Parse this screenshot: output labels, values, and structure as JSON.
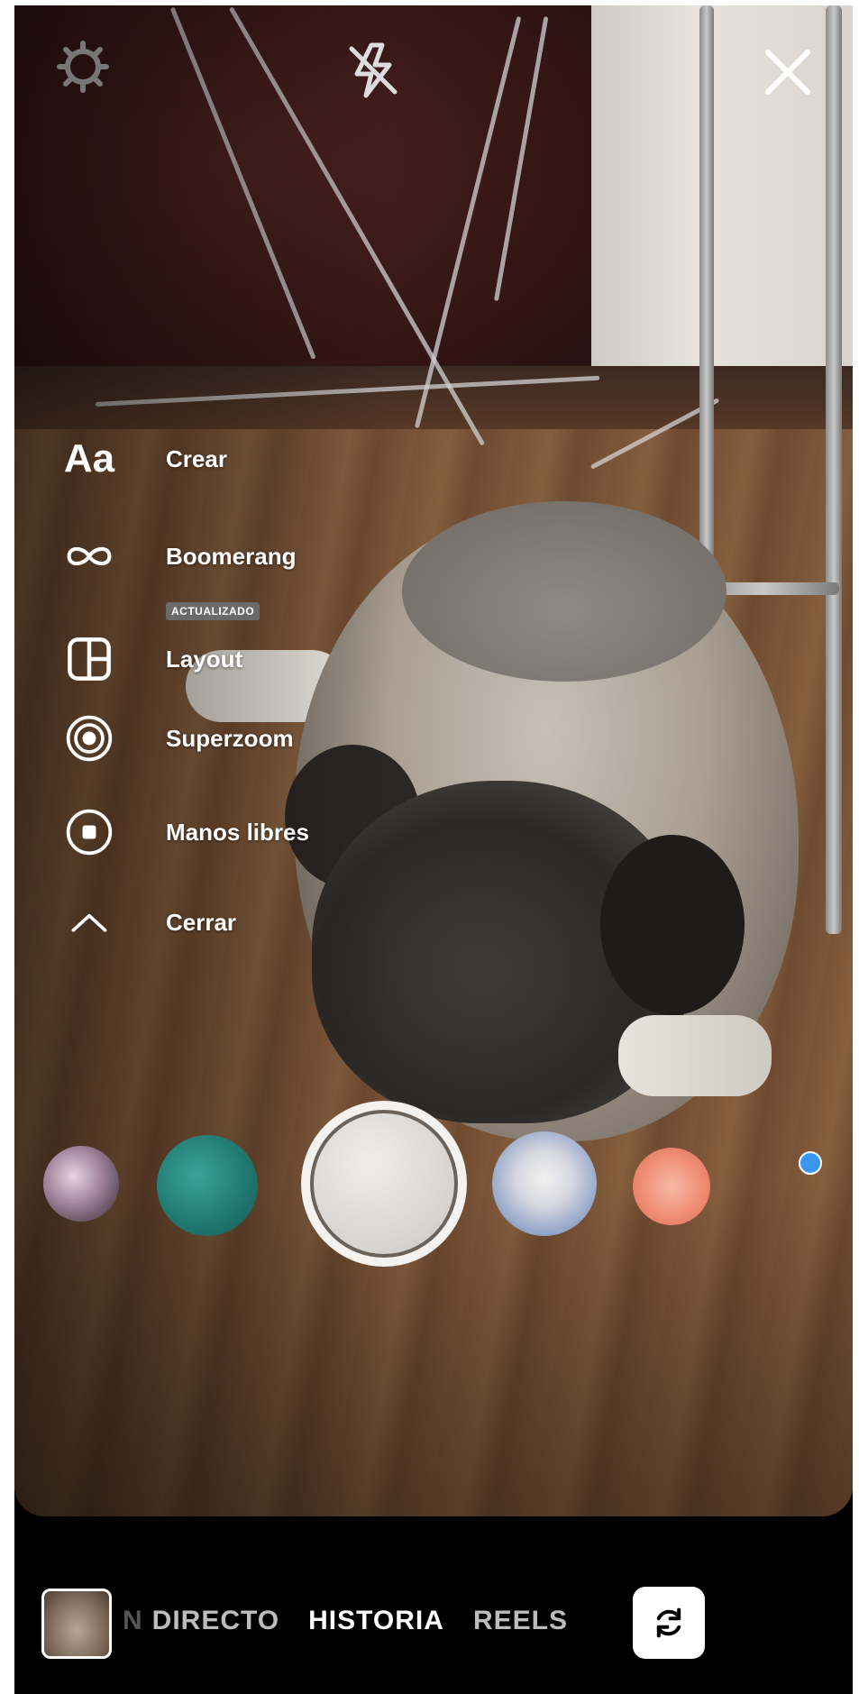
{
  "top_bar": {
    "settings_icon": "gear-icon",
    "flash_icon": "flash-off-icon",
    "close_icon": "close-icon"
  },
  "create_menu": {
    "items": [
      {
        "icon": "Aa",
        "label": "Crear"
      },
      {
        "icon": "infinity-icon",
        "label": "Boomerang"
      },
      {
        "icon": "layout-icon",
        "label": "Layout",
        "badge": "ACTUALIZADO"
      },
      {
        "icon": "superzoom-icon",
        "label": "Superzoom"
      },
      {
        "icon": "record-icon",
        "label": "Manos libres"
      },
      {
        "icon": "chevron-up-icon",
        "label": "Cerrar"
      }
    ]
  },
  "effects_tray": {
    "items": [
      "effect-1",
      "effect-2",
      "shutter",
      "effect-3",
      "effect-4"
    ],
    "new_indicator_color": "#3897f0"
  },
  "bottom_bar": {
    "modes": [
      {
        "label": "N",
        "state": "faded"
      },
      {
        "label": "DIRECTO",
        "state": "dim"
      },
      {
        "label": "HISTORIA",
        "state": "active"
      },
      {
        "label": "REELS",
        "state": "dim"
      }
    ],
    "flip_icon": "camera-flip-icon"
  },
  "colors": {
    "background": "#000000",
    "text": "#ffffff",
    "badge": "#6a6a6a"
  }
}
